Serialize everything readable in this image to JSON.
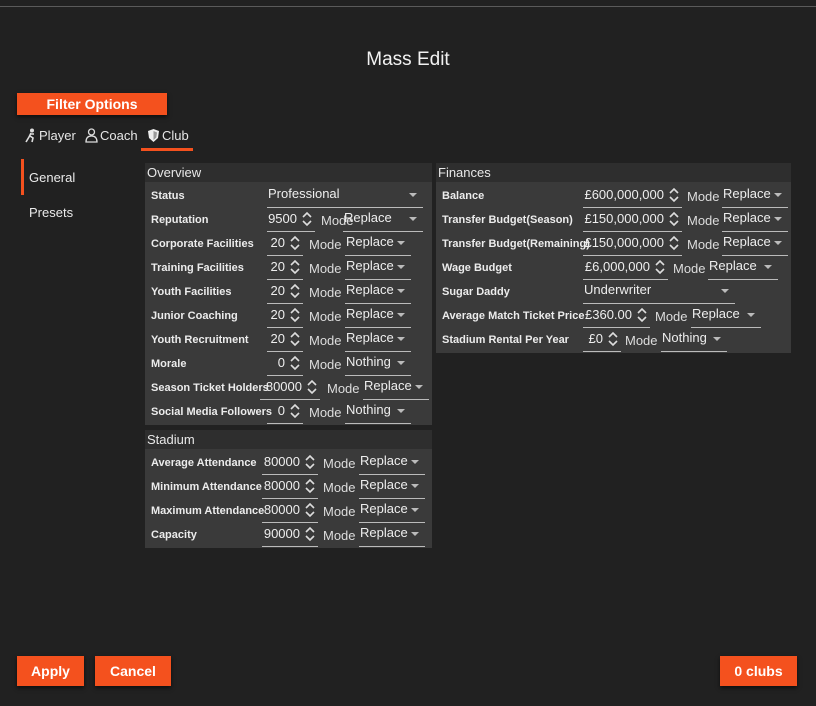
{
  "title": "Mass Edit",
  "filter_button": "Filter Options",
  "tabs": [
    {
      "label": "Player",
      "icon": "player-icon"
    },
    {
      "label": "Coach",
      "icon": "coach-icon"
    },
    {
      "label": "Club",
      "icon": "club-shield-icon"
    }
  ],
  "sidebar": [
    "General",
    "Presets"
  ],
  "mode_label": "Mode",
  "overview": {
    "title": "Overview",
    "status": {
      "label": "Status",
      "value": "Professional"
    },
    "rows": [
      {
        "label": "Reputation",
        "value": "9500",
        "mode": "Replace"
      },
      {
        "label": "Corporate Facilities",
        "value": "20",
        "mode": "Replace"
      },
      {
        "label": "Training Facilities",
        "value": "20",
        "mode": "Replace"
      },
      {
        "label": "Youth Facilities",
        "value": "20",
        "mode": "Replace"
      },
      {
        "label": "Junior Coaching",
        "value": "20",
        "mode": "Replace"
      },
      {
        "label": "Youth Recruitment",
        "value": "20",
        "mode": "Replace"
      },
      {
        "label": "Morale",
        "value": "0",
        "mode": "Nothing"
      },
      {
        "label": "Season Ticket Holders",
        "value": "80000",
        "mode": "Replace"
      },
      {
        "label": "Social Media Followers",
        "value": "0",
        "mode": "Nothing"
      }
    ]
  },
  "stadium": {
    "title": "Stadium",
    "rows": [
      {
        "label": "Average Attendance",
        "value": "80000",
        "mode": "Replace"
      },
      {
        "label": "Minimum Attendance",
        "value": "80000",
        "mode": "Replace"
      },
      {
        "label": "Maximum Attendance",
        "value": "80000",
        "mode": "Replace"
      },
      {
        "label": "Capacity",
        "value": "90000",
        "mode": "Replace"
      }
    ]
  },
  "finances": {
    "title": "Finances",
    "rows": [
      {
        "label": "Balance",
        "value": "£600,000,000",
        "mode": "Replace"
      },
      {
        "label": "Transfer Budget(Season)",
        "value": "£150,000,000",
        "mode": "Replace"
      },
      {
        "label": "Transfer Budget(Remaining)",
        "value": "£150,000,000",
        "mode": "Replace"
      },
      {
        "label": "Wage Budget",
        "value": "£6,000,000",
        "mode": "Replace"
      },
      {
        "label": "Sugar Daddy",
        "select": "Underwriter"
      },
      {
        "label": "Average Match Ticket Price",
        "value": "£360.00",
        "mode": "Replace"
      },
      {
        "label": "Stadium Rental Per Year",
        "value": "£0",
        "mode": "Nothing"
      }
    ]
  },
  "footer": {
    "apply": "Apply",
    "cancel": "Cancel",
    "count": "0 clubs"
  }
}
